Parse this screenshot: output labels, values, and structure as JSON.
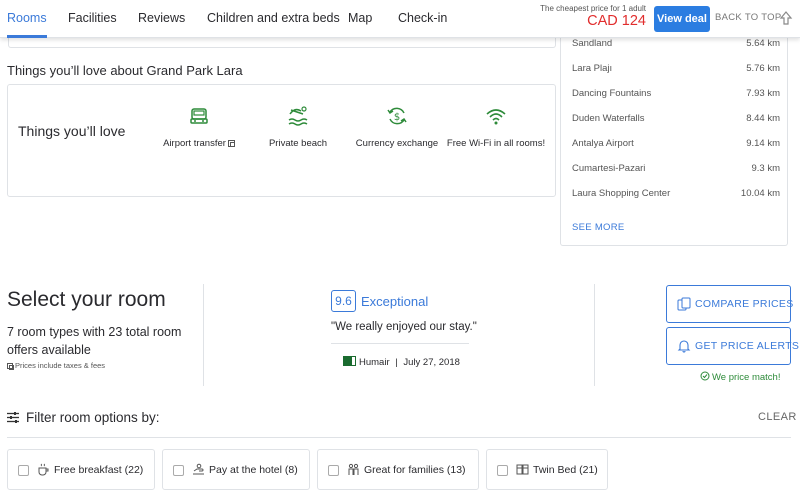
{
  "nav": {
    "tabs": [
      {
        "label": "Rooms",
        "active": true
      },
      {
        "label": "Facilities"
      },
      {
        "label": "Reviews"
      },
      {
        "label": "Children and extra beds"
      },
      {
        "label": "Map"
      },
      {
        "label": "Check-in"
      }
    ],
    "price_caption": "The cheapest price for 1 adult",
    "price_value": "CAD 124",
    "view_deal_label": "View deal",
    "back_to_top_label": "BACK TO TOP"
  },
  "things": {
    "title": "Things you’ll love about Grand Park Lara",
    "box_label": "Things you’ll love",
    "amenities": [
      {
        "label": "Airport transfer",
        "icon": "car-icon"
      },
      {
        "label": "Private beach",
        "icon": "beach-icon"
      },
      {
        "label": "Currency exchange",
        "icon": "currency-exchange-icon"
      },
      {
        "label": "Free Wi-Fi in all rooms!",
        "icon": "wifi-icon"
      }
    ]
  },
  "landmarks": {
    "items": [
      {
        "name": "Sandland",
        "distance": "5.64 km"
      },
      {
        "name": "Lara Plajı",
        "distance": "5.76 km"
      },
      {
        "name": "Dancing Fountains",
        "distance": "7.93 km"
      },
      {
        "name": "Duden Waterfalls",
        "distance": "8.44 km"
      },
      {
        "name": "Antalya Airport",
        "distance": "9.14 km"
      },
      {
        "name": "Cumartesi-Pazari",
        "distance": "9.3 km"
      },
      {
        "name": "Laura Shopping Center",
        "distance": "10.04 km"
      }
    ],
    "see_more_label": "SEE MORE"
  },
  "select_room": {
    "title": "Select your room",
    "summary": "7 room types with 23 total room offers available",
    "taxes_note": "Prices include taxes & fees"
  },
  "review": {
    "score": "9.6",
    "score_word": "Exceptional",
    "quote": "\"We really enjoyed our stay.\"",
    "author": "Humair",
    "date": "July 27, 2018",
    "separator": "|"
  },
  "actions": {
    "compare_prices_label": "COMPARE PRICES",
    "price_alerts_label": "GET PRICE ALERTS",
    "price_match_label": "We price match!"
  },
  "filter": {
    "title": "Filter room options by:",
    "clear_label": "CLEAR",
    "options": [
      {
        "label": "Free breakfast (22)",
        "icon": "breakfast-icon"
      },
      {
        "label": "Pay at the hotel (8)",
        "icon": "pay-at-hotel-icon"
      },
      {
        "label": "Great for families (13)",
        "icon": "family-icon"
      },
      {
        "label": "Twin Bed (21)",
        "icon": "twin-bed-icon"
      }
    ]
  },
  "colors": {
    "accent_blue": "#2b7de1",
    "link_blue": "#3b7ad9",
    "price_red": "#e12d2d",
    "amenity_green": "#2e8b3a"
  }
}
